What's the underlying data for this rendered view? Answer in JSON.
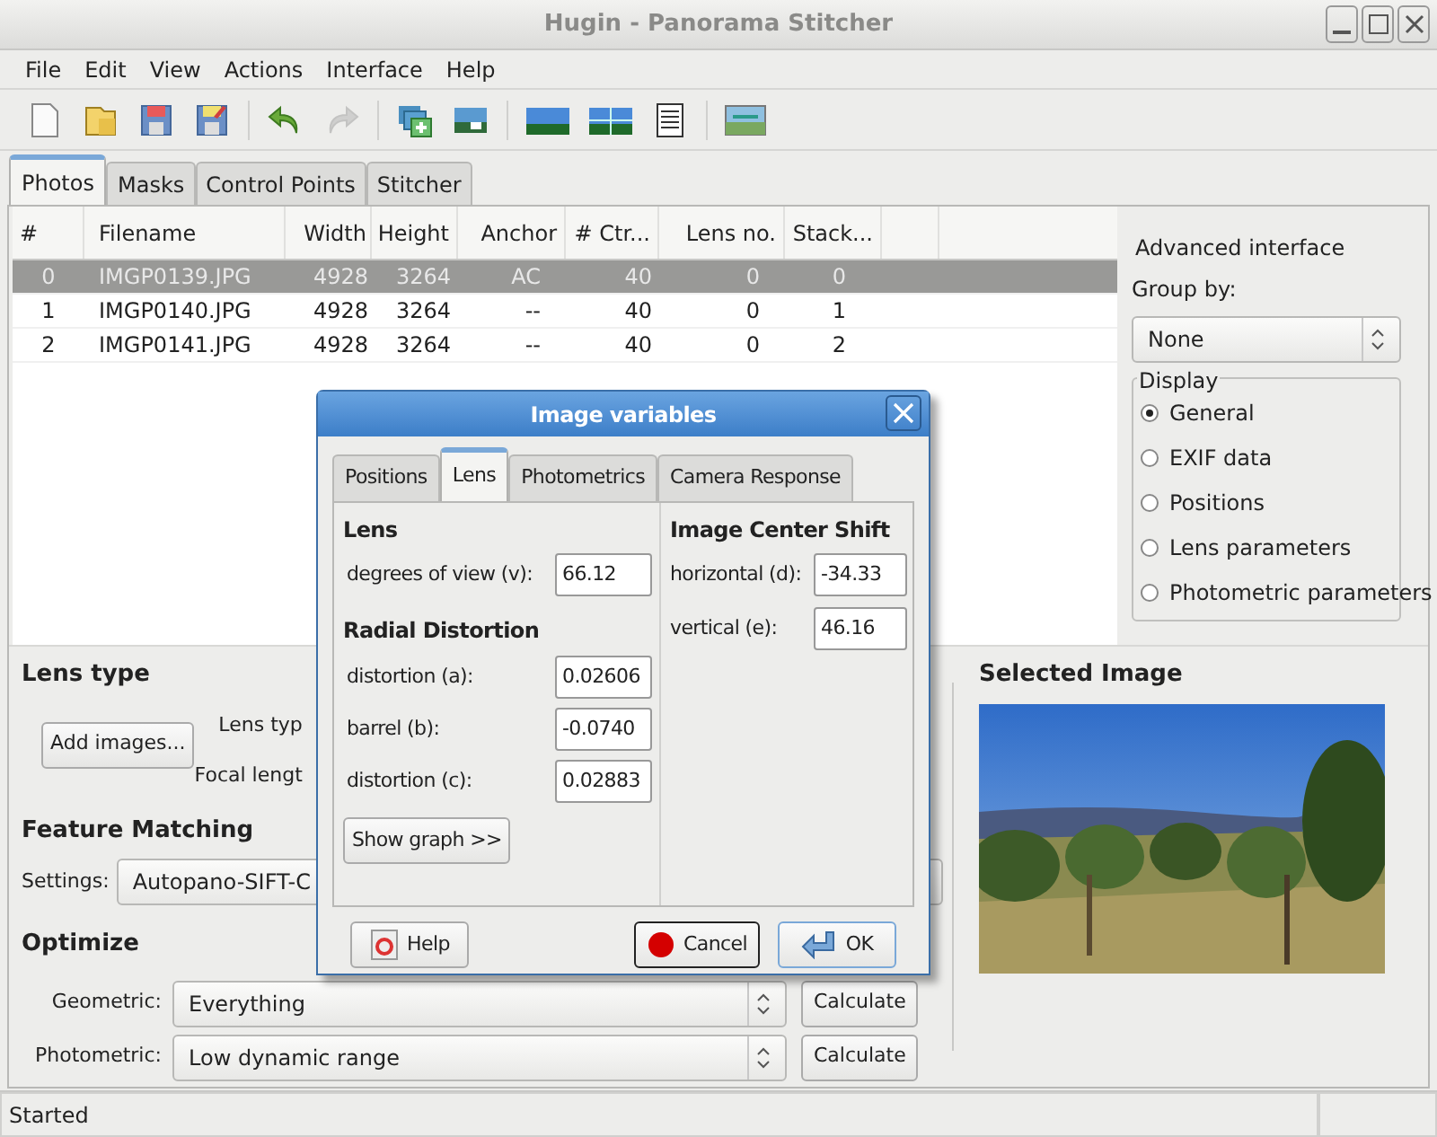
{
  "window": {
    "title": "Hugin - Panorama Stitcher"
  },
  "menu": [
    "File",
    "Edit",
    "View",
    "Actions",
    "Interface",
    "Help"
  ],
  "toolbar_groups": [
    {
      "items": [
        {
          "kind": "new",
          "disabled": false
        },
        {
          "kind": "open",
          "disabled": false
        },
        {
          "kind": "save",
          "disabled": false
        },
        {
          "kind": "save_as",
          "disabled": false
        }
      ]
    },
    {
      "items": [
        {
          "kind": "undo",
          "disabled": false
        },
        {
          "kind": "redo",
          "disabled": true
        }
      ]
    },
    {
      "items": [
        {
          "kind": "add_images",
          "disabled": false
        },
        {
          "kind": "assistant",
          "disabled": false
        }
      ]
    },
    {
      "items": [
        {
          "kind": "preview_gl",
          "disabled": false
        },
        {
          "kind": "preview",
          "disabled": false
        },
        {
          "kind": "list",
          "disabled": false
        }
      ]
    },
    {
      "items": [
        {
          "kind": "panorama",
          "disabled": false
        }
      ]
    }
  ],
  "tabs": [
    {
      "label": "Photos",
      "selected": true
    },
    {
      "label": "Masks",
      "selected": false
    },
    {
      "label": "Control Points",
      "selected": false
    },
    {
      "label": "Stitcher",
      "selected": false
    }
  ],
  "table": {
    "columns": [
      "#",
      "Filename",
      "Width",
      "Height",
      "Anchor",
      "# Ctr...",
      "Lens no.",
      "Stack..."
    ],
    "rows": [
      {
        "cells": [
          "0",
          "IMGP0139.JPG",
          "4928",
          "3264",
          "AC",
          "40",
          "0",
          "0"
        ],
        "selected": true
      },
      {
        "cells": [
          "1",
          "IMGP0140.JPG",
          "4928",
          "3264",
          "--",
          "40",
          "0",
          "1"
        ],
        "selected": false
      },
      {
        "cells": [
          "2",
          "IMGP0141.JPG",
          "4928",
          "3264",
          "--",
          "40",
          "0",
          "2"
        ],
        "selected": false
      }
    ]
  },
  "side_panel": {
    "advanced": "Advanced interface",
    "group_by": {
      "label": "Group by:",
      "value": "None"
    },
    "display": {
      "title": "Display",
      "options": [
        {
          "label": "General",
          "selected": true
        },
        {
          "label": "EXIF data",
          "selected": false
        },
        {
          "label": "Positions",
          "selected": false
        },
        {
          "label": "Lens parameters",
          "selected": false
        },
        {
          "label": "Photometric parameters",
          "selected": false
        }
      ]
    }
  },
  "lens_type": {
    "title": "Lens type",
    "add_button": "Add images...",
    "labels": [
      "Lens typ",
      "Focal lengt"
    ]
  },
  "feature_matching": {
    "title": "Feature Matching",
    "label": "Settings:",
    "value": "Autopano-SIFT-C"
  },
  "optimize": {
    "title": "Optimize",
    "rows": [
      {
        "label": "Geometric:",
        "value": "Everything",
        "button": "Calculate"
      },
      {
        "label": "Photometric:",
        "value": "Low dynamic range",
        "button": "Calculate"
      }
    ]
  },
  "selected_image": {
    "title": "Selected Image"
  },
  "status_bar": {
    "text": "Started"
  },
  "dialog": {
    "title": "Image variables",
    "tabs": [
      {
        "label": "Positions",
        "selected": false
      },
      {
        "label": "Lens",
        "selected": true
      },
      {
        "label": "Photometrics",
        "selected": false
      },
      {
        "label": "Camera Response",
        "selected": false
      }
    ],
    "lens": {
      "title": "Lens",
      "fields": [
        {
          "label": "degrees of view (v):",
          "value": "66.12"
        }
      ]
    },
    "radial": {
      "title": "Radial Distortion",
      "fields": [
        {
          "label": "distortion (a):",
          "value": "0.02606"
        },
        {
          "label": "barrel (b):",
          "value": "-0.0740"
        },
        {
          "label": "distortion (c):",
          "value": "0.02883"
        }
      ]
    },
    "show_graph": "Show graph >>",
    "center": {
      "title": "Image Center Shift",
      "fields": [
        {
          "label": "horizontal (d):",
          "value": "-34.33"
        },
        {
          "label": "vertical (e):",
          "value": "46.16"
        }
      ]
    },
    "buttons": [
      {
        "kind": "help",
        "label": "Help"
      },
      {
        "kind": "cancel",
        "label": "Cancel"
      },
      {
        "kind": "ok",
        "label": "OK"
      }
    ]
  }
}
